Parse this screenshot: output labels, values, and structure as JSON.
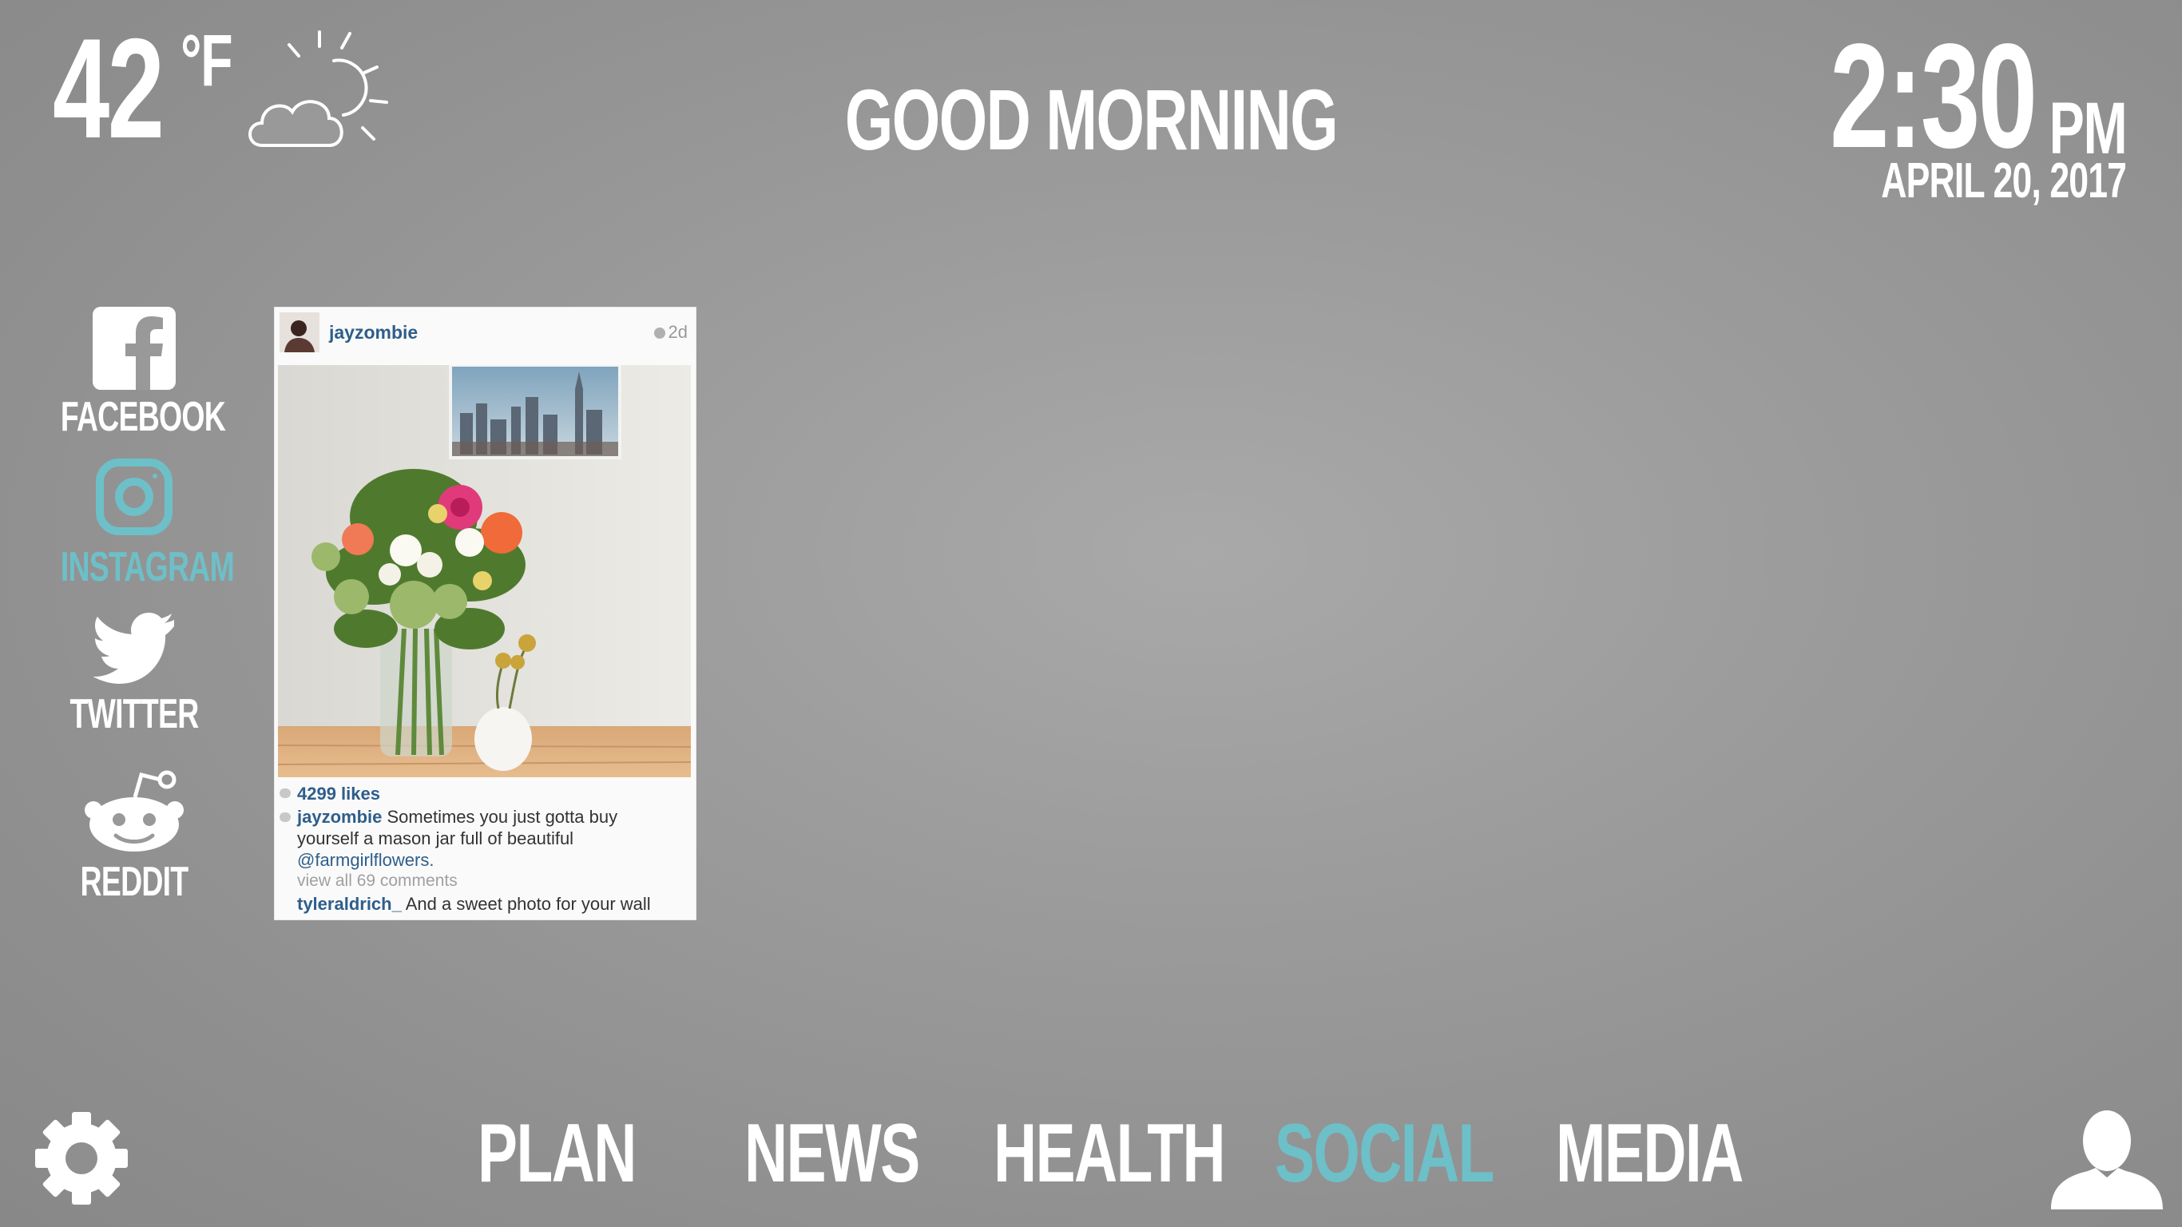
{
  "weather": {
    "temperature": "42",
    "unit": "°F",
    "icon": "partly-sunny-icon"
  },
  "greeting": "GOOD MORNING",
  "clock": {
    "time": "2:30",
    "period": "PM",
    "date": "APRIL 20, 2017"
  },
  "sidebar": {
    "items": [
      {
        "label": "FACEBOOK",
        "icon": "facebook-icon",
        "active": false
      },
      {
        "label": "INSTAGRAM",
        "icon": "instagram-icon",
        "active": true
      },
      {
        "label": "TWITTER",
        "icon": "twitter-icon",
        "active": false
      },
      {
        "label": "REDDIT",
        "icon": "reddit-icon",
        "active": false
      }
    ]
  },
  "post": {
    "username": "jayzombie",
    "age": "2d",
    "likes": "4299 likes",
    "caption_user": "jayzombie",
    "caption_text": "Sometimes you just gotta buy yourself a mason jar full of beautiful",
    "caption_mention": "@farmgirlflowers.",
    "view_all": "view all 69 comments",
    "comment_user": "tyleraldrich_",
    "comment_text": "And a sweet photo for your wall"
  },
  "nav": {
    "tabs": [
      {
        "label": "PLAN",
        "active": false
      },
      {
        "label": "NEWS",
        "active": false
      },
      {
        "label": "HEALTH",
        "active": false
      },
      {
        "label": "SOCIAL",
        "active": true
      },
      {
        "label": "MEDIA",
        "active": false
      }
    ]
  },
  "colors": {
    "accent": "#6dc0c8",
    "text": "#ffffff",
    "link": "#2e5e8a"
  }
}
